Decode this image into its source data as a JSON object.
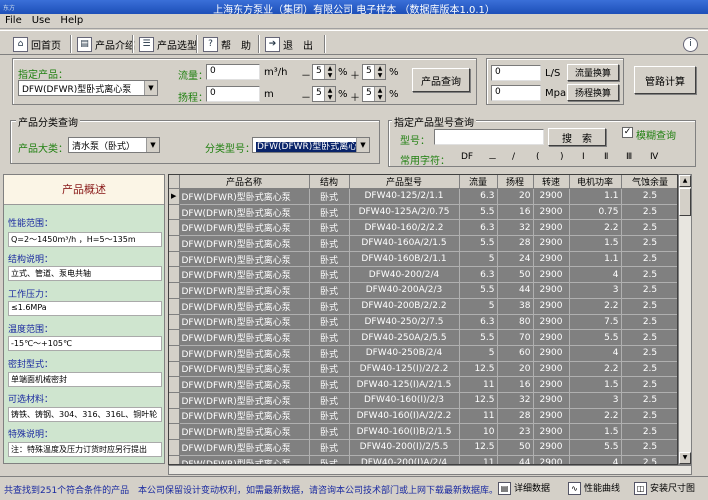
{
  "window": {
    "title": "上海东方泵业（集团）有限公司 电子样本 （数据库版本1.0.1）",
    "app_badge": "东方",
    "accent": "#1d4fb8"
  },
  "menu": {
    "file": "File",
    "use": "Use",
    "help": "Help"
  },
  "toolbar": {
    "home": "回首页",
    "intro": "产品介绍",
    "select": "产品选型",
    "help": "帮　助",
    "exit": "退　出"
  },
  "spec": {
    "label": "指定产品：",
    "product_value": "DFW(DFWR)型卧式离心泵",
    "flow_label": "流量：",
    "flow_value": "0",
    "flow_unit": "m³/h",
    "head_label": "扬程：",
    "head_value": "0",
    "head_unit": "m",
    "tol1_minus": "5",
    "tol1_plus": "5",
    "tol2_minus": "5",
    "tol2_plus": "5",
    "minus_sym": "－",
    "plus_sym": "＋",
    "percent": "%",
    "query_button": "产品查询"
  },
  "convert": {
    "flow_value": "0",
    "flow_unit": "L/S",
    "flow_button": "流量换算",
    "head_value": "0",
    "head_unit": "Mpa",
    "head_button": "扬程换算",
    "pipe_button": "管路计算"
  },
  "category": {
    "group_title": "产品分类查询",
    "major_label": "产品大类：",
    "major_value": "清水泵（卧式）",
    "type_label": "分类型号：",
    "type_value": "DFW(DFWR)型卧式离心泵"
  },
  "model_search": {
    "group_title": "指定产品型号查询",
    "model_label": "型号：",
    "model_value": "",
    "search_button": "搜　索",
    "fuzzy_label": "模糊查询",
    "fuzzy_checked": "✓",
    "common_label": "常用字符：",
    "chars": [
      "DF",
      "－",
      "/",
      "(",
      ")",
      "Ⅰ",
      "Ⅱ",
      "Ⅲ",
      "Ⅳ"
    ]
  },
  "overview": {
    "title": "产品概述",
    "sections": [
      {
        "label": "性能范围：",
        "value": "Q=2～1450m³/h ，H=5～135m"
      },
      {
        "label": "结构说明：",
        "value": "立式、管道、泵电共轴"
      },
      {
        "label": "工作压力：",
        "value": "≤1.6MPa"
      },
      {
        "label": "温度范围：",
        "value": "-15℃～+105℃"
      },
      {
        "label": "密封型式：",
        "value": "单端面机械密封"
      },
      {
        "label": "可选材料：",
        "value": "铸铁、铸钢、304、316、316L、铜叶轮"
      },
      {
        "label": "特殊说明：",
        "value": "注：特殊温度及压力订货时应另行提出"
      }
    ]
  },
  "table": {
    "headers": [
      "产品名称",
      "结构",
      "产品型号",
      "流量",
      "扬程",
      "转速",
      "电机功率",
      "气蚀余量"
    ],
    "rows": [
      [
        "DFW(DFWR)型卧式离心泵",
        "卧式",
        "DFW40-125/2/1.1",
        "6.3",
        "20",
        "2900",
        "1.1",
        "2.5"
      ],
      [
        "DFW(DFWR)型卧式离心泵",
        "卧式",
        "DFW40-125A/2/0.75",
        "5.5",
        "16",
        "2900",
        "0.75",
        "2.5"
      ],
      [
        "DFW(DFWR)型卧式离心泵",
        "卧式",
        "DFW40-160/2/2.2",
        "6.3",
        "32",
        "2900",
        "2.2",
        "2.5"
      ],
      [
        "DFW(DFWR)型卧式离心泵",
        "卧式",
        "DFW40-160A/2/1.5",
        "5.5",
        "28",
        "2900",
        "1.5",
        "2.5"
      ],
      [
        "DFW(DFWR)型卧式离心泵",
        "卧式",
        "DFW40-160B/2/1.1",
        "5",
        "24",
        "2900",
        "1.1",
        "2.5"
      ],
      [
        "DFW(DFWR)型卧式离心泵",
        "卧式",
        "DFW40-200/2/4",
        "6.3",
        "50",
        "2900",
        "4",
        "2.5"
      ],
      [
        "DFW(DFWR)型卧式离心泵",
        "卧式",
        "DFW40-200A/2/3",
        "5.5",
        "44",
        "2900",
        "3",
        "2.5"
      ],
      [
        "DFW(DFWR)型卧式离心泵",
        "卧式",
        "DFW40-200B/2/2.2",
        "5",
        "38",
        "2900",
        "2.2",
        "2.5"
      ],
      [
        "DFW(DFWR)型卧式离心泵",
        "卧式",
        "DFW40-250/2/7.5",
        "6.3",
        "80",
        "2900",
        "7.5",
        "2.5"
      ],
      [
        "DFW(DFWR)型卧式离心泵",
        "卧式",
        "DFW40-250A/2/5.5",
        "5.5",
        "70",
        "2900",
        "5.5",
        "2.5"
      ],
      [
        "DFW(DFWR)型卧式离心泵",
        "卧式",
        "DFW40-250B/2/4",
        "5",
        "60",
        "2900",
        "4",
        "2.5"
      ],
      [
        "DFW(DFWR)型卧式离心泵",
        "卧式",
        "DFW40-125(Ⅰ)/2/2.2",
        "12.5",
        "20",
        "2900",
        "2.2",
        "2.5"
      ],
      [
        "DFW(DFWR)型卧式离心泵",
        "卧式",
        "DFW40-125(Ⅰ)A/2/1.5",
        "11",
        "16",
        "2900",
        "1.5",
        "2.5"
      ],
      [
        "DFW(DFWR)型卧式离心泵",
        "卧式",
        "DFW40-160(Ⅰ)/2/3",
        "12.5",
        "32",
        "2900",
        "3",
        "2.5"
      ],
      [
        "DFW(DFWR)型卧式离心泵",
        "卧式",
        "DFW40-160(Ⅰ)A/2/2.2",
        "11",
        "28",
        "2900",
        "2.2",
        "2.5"
      ],
      [
        "DFW(DFWR)型卧式离心泵",
        "卧式",
        "DFW40-160(Ⅰ)B/2/1.5",
        "10",
        "23",
        "2900",
        "1.5",
        "2.5"
      ],
      [
        "DFW(DFWR)型卧式离心泵",
        "卧式",
        "DFW40-200(Ⅰ)/2/5.5",
        "12.5",
        "50",
        "2900",
        "5.5",
        "2.5"
      ],
      [
        "DFW(DFWR)型卧式离心泵",
        "卧式",
        "DFW40-200(Ⅰ)A/2/4",
        "11",
        "44",
        "2900",
        "4",
        "2.5"
      ],
      [
        "DFW(DFWR)型卧式离心泵",
        "卧式",
        "DFW40-200(Ⅰ)B/2/3",
        "10",
        "38",
        "2900",
        "3",
        "2.5"
      ],
      [
        "DFW(DFWR)型卧式离心泵",
        "卧式",
        "DFW40-250(Ⅰ)/2/11",
        "12.5",
        "80",
        "2900",
        "11",
        "2.5"
      ],
      [
        "DFW(DFWR)型卧式离心泵",
        "卧式",
        "DFW40-250(Ⅰ)A/2/7.5",
        "11",
        "70",
        "2900",
        "7.5",
        "2.5"
      ]
    ],
    "row_marker": "▶"
  },
  "status": {
    "count": "共查找到251个符合条件的产品",
    "notice": "本公司保留设计变动权利，如需最新数据，请咨询本公司技术部门或上网下载最新数据库。",
    "detail_button": "详细数据",
    "curve_button": "性能曲线",
    "install_button": "安装尺寸图"
  }
}
